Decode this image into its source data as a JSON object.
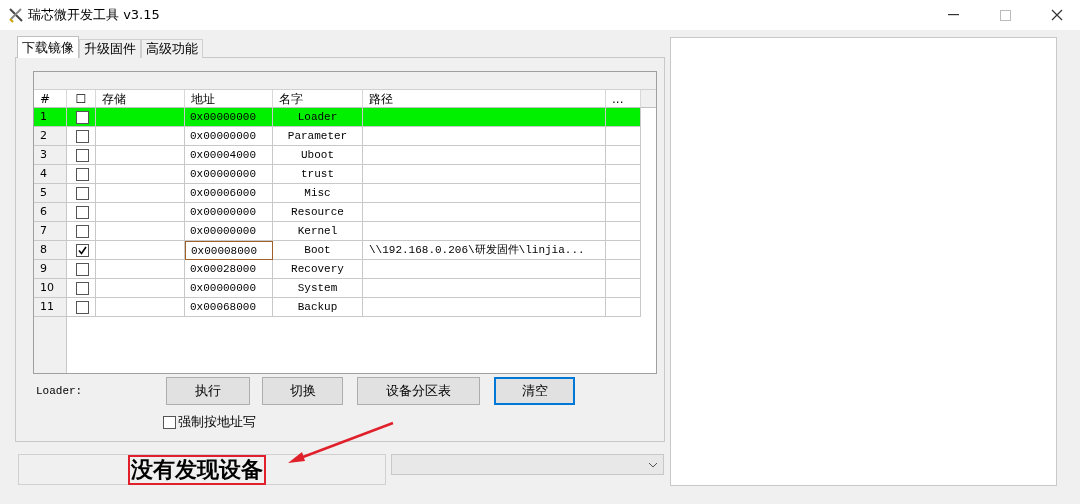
{
  "window": {
    "title": "瑞芯微开发工具 v3.15"
  },
  "tabs": [
    {
      "label": "下载镜像",
      "selected": true
    },
    {
      "label": "升级固件",
      "selected": false
    },
    {
      "label": "高级功能",
      "selected": false
    }
  ],
  "table": {
    "columns": [
      "#",
      "☐",
      "存储",
      "地址",
      "名字",
      "路径",
      "..."
    ],
    "rows": [
      {
        "index": "1",
        "checked": false,
        "selected": true,
        "focused": false,
        "address": "0x00000000",
        "name": "Loader",
        "path": ""
      },
      {
        "index": "2",
        "checked": false,
        "selected": false,
        "focused": false,
        "address": "0x00000000",
        "name": "Parameter",
        "path": ""
      },
      {
        "index": "3",
        "checked": false,
        "selected": false,
        "focused": false,
        "address": "0x00004000",
        "name": "Uboot",
        "path": ""
      },
      {
        "index": "4",
        "checked": false,
        "selected": false,
        "focused": false,
        "address": "0x00000000",
        "name": "trust",
        "path": ""
      },
      {
        "index": "5",
        "checked": false,
        "selected": false,
        "focused": false,
        "address": "0x00006000",
        "name": "Misc",
        "path": ""
      },
      {
        "index": "6",
        "checked": false,
        "selected": false,
        "focused": false,
        "address": "0x00000000",
        "name": "Resource",
        "path": ""
      },
      {
        "index": "7",
        "checked": false,
        "selected": false,
        "focused": false,
        "address": "0x00000000",
        "name": "Kernel",
        "path": ""
      },
      {
        "index": "8",
        "checked": true,
        "selected": false,
        "focused": true,
        "address": "0x00008000",
        "name": "Boot",
        "path": "\\\\192.168.0.206\\研发固件\\linjia..."
      },
      {
        "index": "9",
        "checked": false,
        "selected": false,
        "focused": false,
        "address": "0x00028000",
        "name": "Recovery",
        "path": ""
      },
      {
        "index": "10",
        "checked": false,
        "selected": false,
        "focused": false,
        "address": "0x00000000",
        "name": "System",
        "path": ""
      },
      {
        "index": "11",
        "checked": false,
        "selected": false,
        "focused": false,
        "address": "0x00068000",
        "name": "Backup",
        "path": ""
      }
    ]
  },
  "loader_label": "Loader:",
  "buttons": [
    {
      "label": "执行",
      "default": false
    },
    {
      "label": "切换",
      "default": false
    },
    {
      "label": "设备分区表",
      "default": false
    },
    {
      "label": "清空",
      "default": true
    }
  ],
  "force_address_write": {
    "label": "强制按地址写",
    "checked": false
  },
  "status": {
    "text": "没有发现设备",
    "highlighted": true
  }
}
